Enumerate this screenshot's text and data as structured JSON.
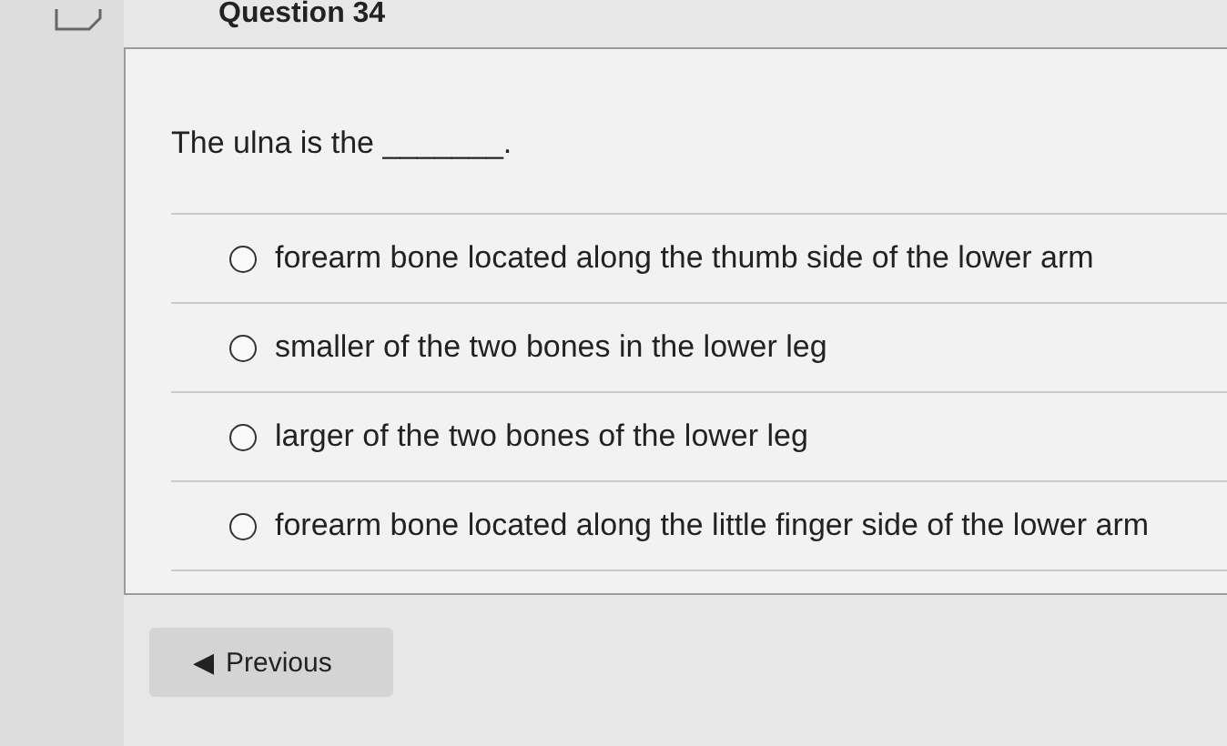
{
  "question": {
    "title": "Question 34",
    "text": "The ulna is the _______.",
    "options": [
      {
        "label": "forearm bone located along the thumb side of the lower arm",
        "selected": false
      },
      {
        "label": "smaller of the two bones in the lower leg",
        "selected": false
      },
      {
        "label": "larger of the two bones of the lower leg",
        "selected": false
      },
      {
        "label": "forearm bone located along the little finger side of the lower arm",
        "selected": false
      }
    ]
  },
  "navigation": {
    "previous": {
      "icon": "◀",
      "label": "Previous"
    }
  }
}
